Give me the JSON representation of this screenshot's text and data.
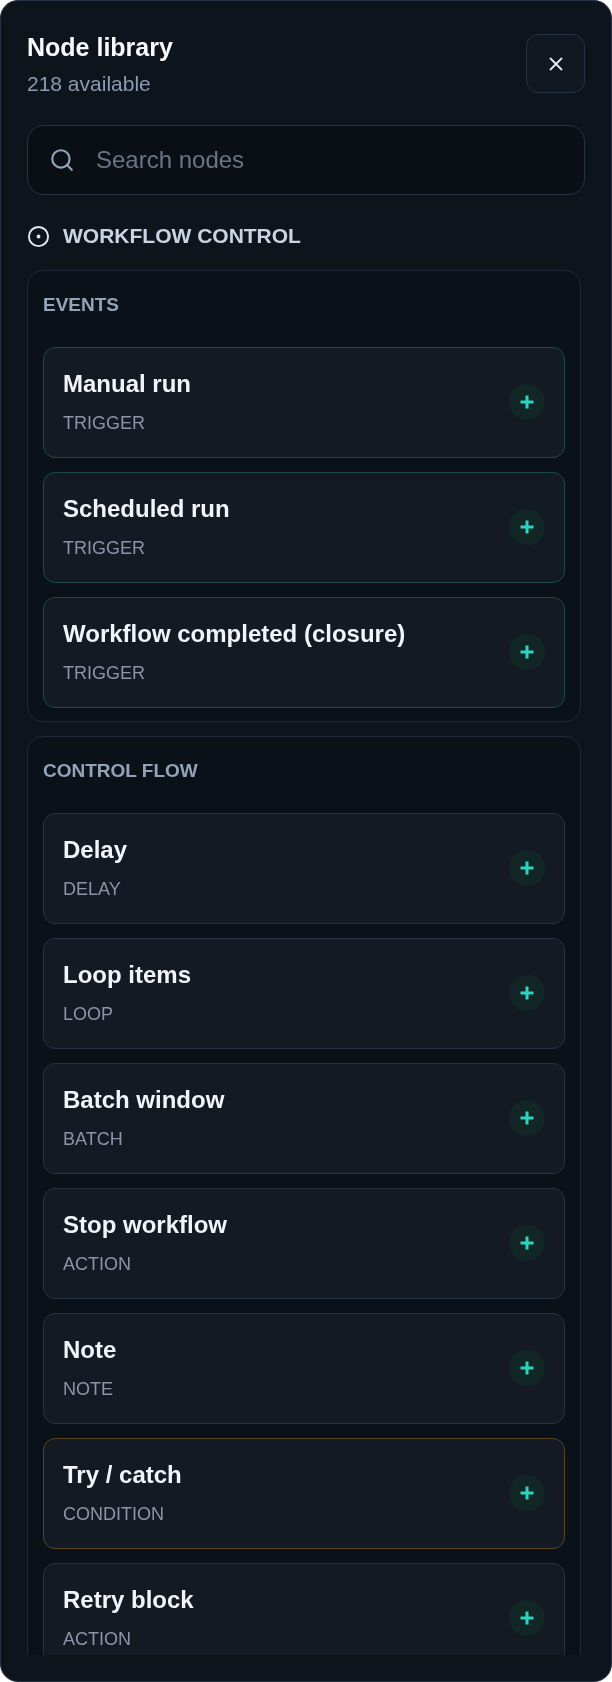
{
  "header": {
    "title": "Node library",
    "subtitle": "218 available"
  },
  "search": {
    "placeholder": "Search nodes"
  },
  "section": {
    "title": "WORKFLOW CONTROL",
    "groups": [
      {
        "label": "EVENTS",
        "nodes": [
          {
            "name": "Manual run",
            "type": "TRIGGER",
            "color": "#1d4a43"
          },
          {
            "name": "Scheduled run",
            "type": "TRIGGER",
            "color": "#1d4a43"
          },
          {
            "name": "Workflow completed (closure)",
            "type": "TRIGGER",
            "color": "#1d4a43"
          }
        ]
      },
      {
        "label": "CONTROL FLOW",
        "nodes": [
          {
            "name": "Delay",
            "type": "DELAY",
            "color": "#273243"
          },
          {
            "name": "Loop items",
            "type": "LOOP",
            "color": "#273243"
          },
          {
            "name": "Batch window",
            "type": "BATCH",
            "color": "#273243"
          },
          {
            "name": "Stop workflow",
            "type": "ACTION",
            "color": "#273243"
          },
          {
            "name": "Note",
            "type": "NOTE",
            "color": "#273243"
          },
          {
            "name": "Try / catch",
            "type": "CONDITION",
            "color": "#5c4421"
          },
          {
            "name": "Retry block",
            "type": "ACTION",
            "color": "#273243"
          }
        ]
      }
    ]
  }
}
